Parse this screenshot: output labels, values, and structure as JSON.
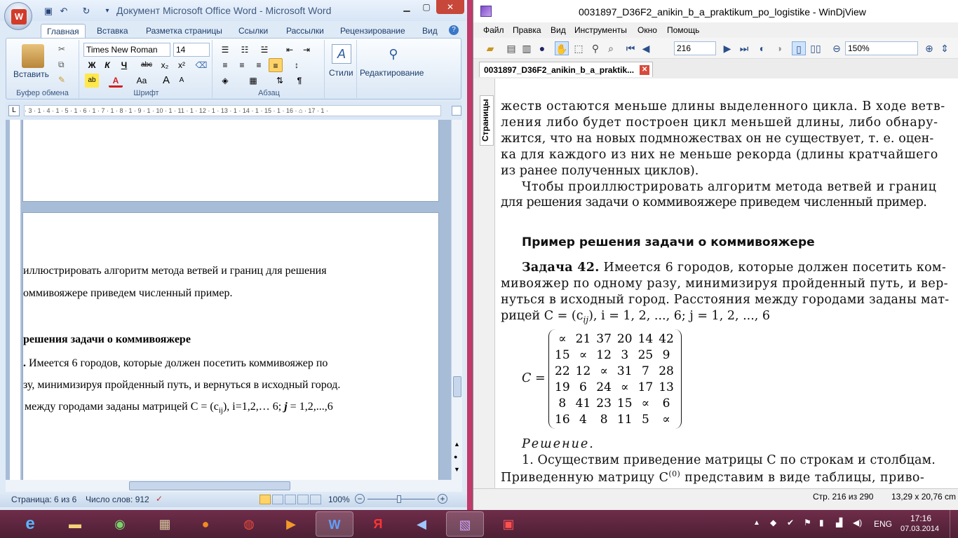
{
  "word": {
    "title": "Документ Microsoft Office Word - Microsoft Word",
    "tabs": [
      "Главная",
      "Вставка",
      "Разметка страницы",
      "Ссылки",
      "Рассылки",
      "Рецензирование",
      "Вид"
    ],
    "ribbon": {
      "paste": "Вставить",
      "clipboard": "Буфер обмена",
      "font_name": "Times New Roman",
      "font_size": "14",
      "font_group": "Шрифт",
      "para_group": "Абзац",
      "styles": "Стили",
      "editing": "Редактирование",
      "bold": "Ж",
      "italic": "К",
      "underline": "Ч",
      "strike": "abc",
      "sub": "x₂",
      "sup": "x²",
      "case": "Aa",
      "grow": "A",
      "shrink": "A",
      "pilcrow": "¶"
    },
    "ruler_text": "· 3 · 1 · 4 · 1 · 5 · 1 · 6 · 1 · 7 · 1 · 8 · 1 · 9 · 1 · 10 · 1 · 11 · 1 · 12 · 1 · 13 · 1 · 14 · 1 · 15 · 1 · 16 · ⌂ · 17 · 1 ·",
    "doc_lines": [
      "иллюстрировать алгоритм метода ветвей и границ для решения",
      "оммивояжере приведем численный пример.",
      "решения задачи о коммивояжере",
      "Имеется 6 городов, которые должен посетить коммивояжер по",
      "зу, минимизируя пройденный путь, и вернуться в исходный город.",
      "между городами заданы матрицей C = (c",
      "ij",
      "), i=1,2,… 6; ",
      "j",
      " = 1,2,...,6"
    ],
    "status": {
      "page": "Страница: 6 из 6",
      "words": "Число слов: 912",
      "zoom": "100%"
    }
  },
  "djview": {
    "title": "0031897_D36F2_anikin_b_a_praktikum_po_logistike - WinDjView",
    "menu": [
      "Файл",
      "Правка",
      "Вид",
      "Инструменты",
      "Окно",
      "Помощь"
    ],
    "page_field": "216",
    "zoom_field": "150%",
    "tab_label": "0031897_D36F2_anikin_b_a_praktik...",
    "side_label": "Страницы",
    "text_lines": [
      "жеств остаются меньше длины выделенного цикла. В ходе ветв-",
      "ления либо будет построен цикл меньшей длины, либо обнару-",
      "жится, что на новых подмножествах он не существует, т. е. оцен-",
      "ка для каждого из них не меньше рекорда (длины кратчайшего",
      "из ранее полученных циклов).",
      "Чтобы проиллюстрировать алгоритм метода ветвей и границ",
      "для решения задачи о коммивояжере приведем численный пример."
    ],
    "heading": "Пример решения задачи о коммивояжере",
    "task_label": "Задача 42.",
    "task_lines": [
      "Имеется 6 городов, которые должен посетить ком-",
      "мивояжер по одному разу, минимизируя пройденный путь, и вер-",
      "нуться в исходный город. Расстояния между городами заданы мат-",
      "рицей  C = (c",
      "ij",
      "),  i = 1, 2, ..., 6;  j = 1, 2, ..., 6"
    ],
    "matrix_label": "C =",
    "matrix": [
      [
        "∝",
        "21",
        "37",
        "20",
        "14",
        "42"
      ],
      [
        "15",
        "∝",
        "12",
        "3",
        "25",
        "9"
      ],
      [
        "22",
        "12",
        "∝",
        "31",
        "7",
        "28"
      ],
      [
        "19",
        "6",
        "24",
        "∝",
        "17",
        "13"
      ],
      [
        "8",
        "41",
        "23",
        "15",
        "∝",
        "6"
      ],
      [
        "16",
        "4",
        "8",
        "11",
        "5",
        "∝"
      ]
    ],
    "solution_label": "Решение.",
    "solution_lines": [
      "1. Осуществим приведение матрицы C по строкам и столбцам.",
      "Приведенную матрицу C",
      "(0)",
      " представим в виде таблицы, приво-"
    ],
    "status_page": "Стр. 216 из 290",
    "status_size": "13,29 x 20,76 cm"
  },
  "taskbar": {
    "lang": "ENG",
    "time": "17:16",
    "date": "07.03.2014"
  }
}
